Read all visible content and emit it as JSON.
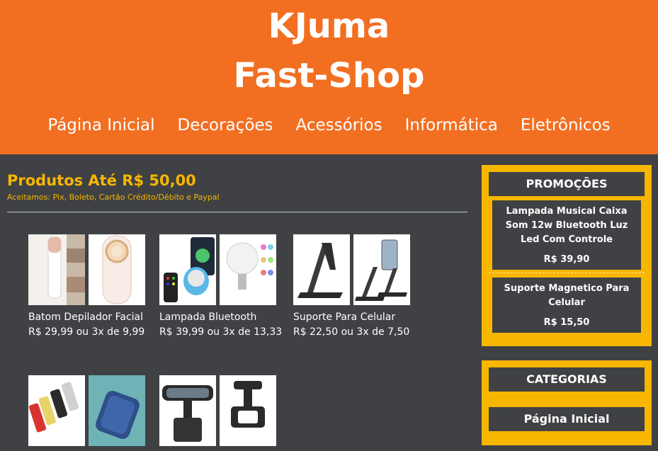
{
  "header": {
    "title_line1": "KJuma",
    "title_line2": "Fast-Shop"
  },
  "nav": [
    "Página Inicial",
    "Decorações",
    "Acessórios",
    "Informática",
    "Eletrônicos"
  ],
  "section": {
    "title": "Produtos Até R$ 50,00",
    "subtitle": "Aceitamos: Pix, Boleto, Cartão Crédito/Débito e Paypal"
  },
  "products": [
    {
      "name": "Batom Depilador Facial",
      "price": "R$ 29,99 ou 3x de 9,99"
    },
    {
      "name": "Lampada Bluetooth",
      "price": "R$ 39,99 ou 3x de 13,33"
    },
    {
      "name": "Suporte Para Celular",
      "price": "R$ 22,50 ou 3x de 7,50"
    },
    {
      "name": "",
      "price": ""
    },
    {
      "name": "",
      "price": ""
    }
  ],
  "sidebar": {
    "promo_title": "PROMOÇÕES",
    "promos": [
      {
        "name": "Lampada Musical Caixa Som 12w Bluetooth Luz Led Com Controle",
        "price": "R$ 39,90"
      },
      {
        "name": "Suporte Magnetico Para Celular",
        "price": "R$ 15,50"
      }
    ],
    "categories_title": "CATEGORIAS",
    "categories": [
      "Página Inicial"
    ]
  },
  "colors": {
    "brand": "#f26f22",
    "accent": "#f7b600",
    "background": "#3f4144"
  },
  "icons": [
    "lipstick-epilator-image",
    "bluetooth-bulb-image",
    "phone-stand-image",
    "car-mount-image"
  ]
}
